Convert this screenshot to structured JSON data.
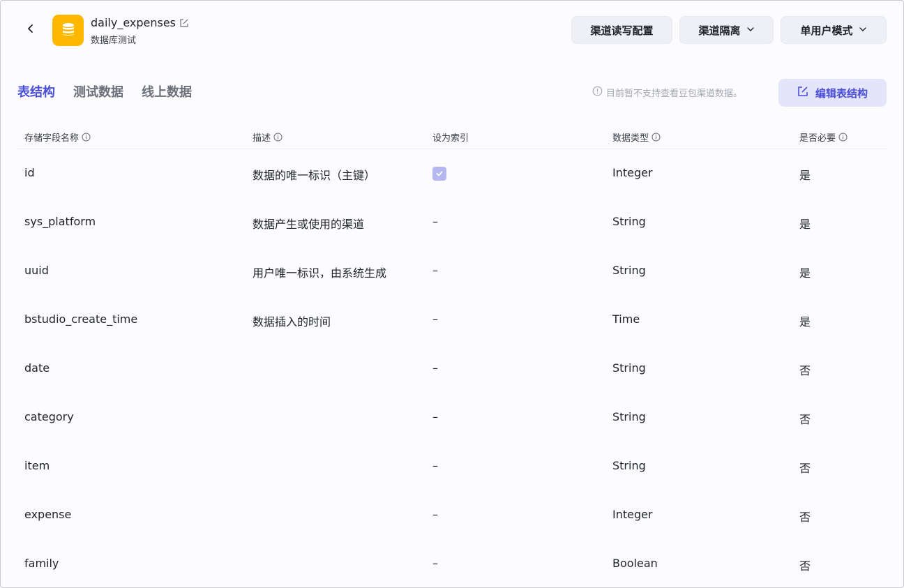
{
  "header": {
    "db_name": "daily_expenses",
    "db_subtitle": "数据库测试",
    "logo_color": "#ffb800",
    "icons": {
      "back": "chevron-left-icon",
      "logo": "database-icon",
      "edit": "edit-icon"
    },
    "buttons": {
      "config": "渠道读写配置",
      "isolation": "渠道隔离",
      "mode": "单用户模式"
    }
  },
  "tabs": [
    {
      "label": "表结构",
      "active": true
    },
    {
      "label": "测试数据",
      "active": false
    },
    {
      "label": "线上数据",
      "active": false
    }
  ],
  "notice": "目前暂不支持查看豆包渠道数据。",
  "edit_struct_label": "编辑表结构",
  "accent_color": "#4b4fd6",
  "table": {
    "columns": [
      "存储字段名称",
      "描述",
      "设为索引",
      "数据类型",
      "是否必要"
    ],
    "rows": [
      {
        "name": "id",
        "desc": "数据的唯一标识（主键）",
        "index": true,
        "type": "Integer",
        "required": "是"
      },
      {
        "name": "sys_platform",
        "desc": "数据产生或使用的渠道",
        "index": "–",
        "type": "String",
        "required": "是"
      },
      {
        "name": "uuid",
        "desc": "用户唯一标识，由系统生成",
        "index": "–",
        "type": "String",
        "required": "是"
      },
      {
        "name": "bstudio_create_time",
        "desc": "数据插入的时间",
        "index": "–",
        "type": "Time",
        "required": "是"
      },
      {
        "name": "date",
        "desc": "",
        "index": "–",
        "type": "String",
        "required": "否"
      },
      {
        "name": "category",
        "desc": "",
        "index": "–",
        "type": "String",
        "required": "否"
      },
      {
        "name": "item",
        "desc": "",
        "index": "–",
        "type": "String",
        "required": "否"
      },
      {
        "name": "expense",
        "desc": "",
        "index": "–",
        "type": "Integer",
        "required": "否"
      },
      {
        "name": "family",
        "desc": "",
        "index": "–",
        "type": "Boolean",
        "required": "否"
      }
    ]
  }
}
